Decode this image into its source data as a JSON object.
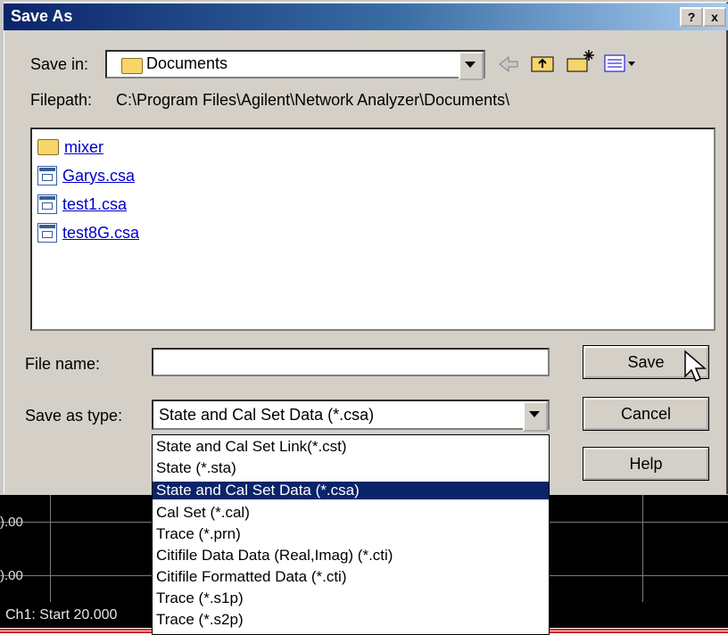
{
  "dialog": {
    "title": "Save As",
    "help_btn": "?",
    "close_btn": "x",
    "save_in_label": "Save in:",
    "save_in_value": "Documents",
    "filepath_label": "Filepath:",
    "filepath_value": "C:\\Program Files\\Agilent\\Network Analyzer\\Documents\\",
    "files": [
      {
        "name": "mixer",
        "icon": "folder-icon"
      },
      {
        "name": "Garys.csa",
        "icon": "csa-file-icon"
      },
      {
        "name": "test1.csa",
        "icon": "csa-file-icon"
      },
      {
        "name": "test8G.csa",
        "icon": "csa-file-icon"
      }
    ],
    "file_name_label": "File name:",
    "file_name_value": "",
    "save_as_type_label": "Save as type:",
    "save_as_type_value": "State and Cal Set Data (*.csa)",
    "save_button": "Save",
    "cancel_button": "Cancel",
    "help_button": "Help",
    "type_options": [
      "State and Cal Set Link(*.cst)",
      "State (*.sta)",
      "State and Cal Set Data (*.csa)",
      "Cal Set (*.cal)",
      "Trace (*.prn)",
      "Citifile Data Data (Real,Imag) (*.cti)",
      "Citifile Formatted Data (*.cti)",
      "Trace (*.s1p)",
      "Trace (*.s2p)"
    ],
    "selected_option_index": 2
  },
  "background": {
    "ytick_top": ").00",
    "ytick_bottom": ").00",
    "status_text": "Ch1: Start  20.000"
  },
  "colors": {
    "title_bar": "#0a246a",
    "selection": "#0a246a"
  }
}
